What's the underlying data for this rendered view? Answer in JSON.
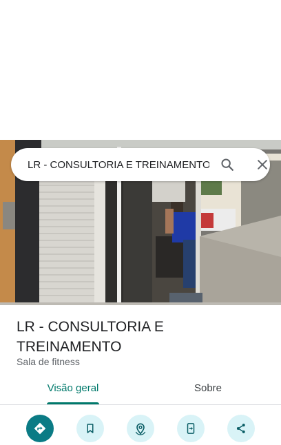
{
  "search": {
    "query": "LR - CONSULTORIA E TREINAMENTO"
  },
  "place": {
    "title": "LR - CONSULTORIA E TREINAMENTO",
    "category": "Sala de fitness"
  },
  "tabs": [
    {
      "label": "Visão geral",
      "selected": true
    },
    {
      "label": "Sobre",
      "selected": false
    }
  ],
  "actions": [
    {
      "icon": "directions-icon"
    },
    {
      "icon": "bookmark-icon"
    },
    {
      "icon": "nearby-icon"
    },
    {
      "icon": "send-to-phone-icon"
    },
    {
      "icon": "share-icon"
    }
  ],
  "colors": {
    "accent": "#00796b",
    "primary_action": "#0b7b85",
    "action_bg": "#d9f3f7"
  }
}
